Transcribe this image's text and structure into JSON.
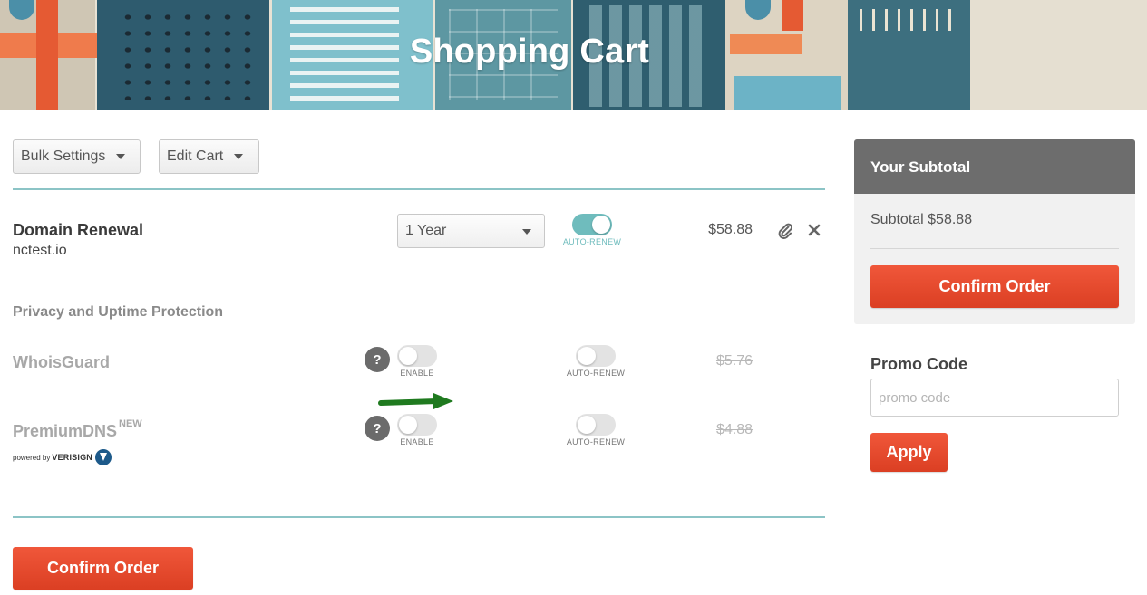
{
  "banner": {
    "title": "Shopping Cart"
  },
  "toolbar": {
    "bulk_settings_label": "Bulk Settings",
    "edit_cart_label": "Edit Cart"
  },
  "cart_item": {
    "title": "Domain Renewal",
    "domain": "nctest.io",
    "duration": "1 Year",
    "auto_renew_label": "AUTO-RENEW",
    "auto_renew_on": true,
    "price": "$58.88"
  },
  "protection": {
    "section_label": "Privacy and Uptime Protection",
    "addons": [
      {
        "name": "WhoisGuard",
        "enable_label": "ENABLE",
        "auto_renew_label": "AUTO-RENEW",
        "price": "$5.76",
        "enabled": false
      },
      {
        "name": "PremiumDNS",
        "badge": "NEW",
        "enable_label": "ENABLE",
        "auto_renew_label": "AUTO-RENEW",
        "price": "$4.88",
        "enabled": false,
        "powered_by_prefix": "powered by",
        "powered_by_brand": "VERISIGN"
      }
    ]
  },
  "help_icon_glyph": "?",
  "confirm_order_label": "Confirm Order",
  "subtotal": {
    "heading": "Your Subtotal",
    "line": "Subtotal $58.88",
    "confirm_label": "Confirm Order"
  },
  "promo": {
    "label": "Promo Code",
    "placeholder": "promo code",
    "apply_label": "Apply"
  },
  "colors": {
    "accent_orange": "#e5492d",
    "teal": "#6fbcbd",
    "panel_header": "#6d6d6d",
    "annotation_arrow": "#1f7a1f"
  }
}
